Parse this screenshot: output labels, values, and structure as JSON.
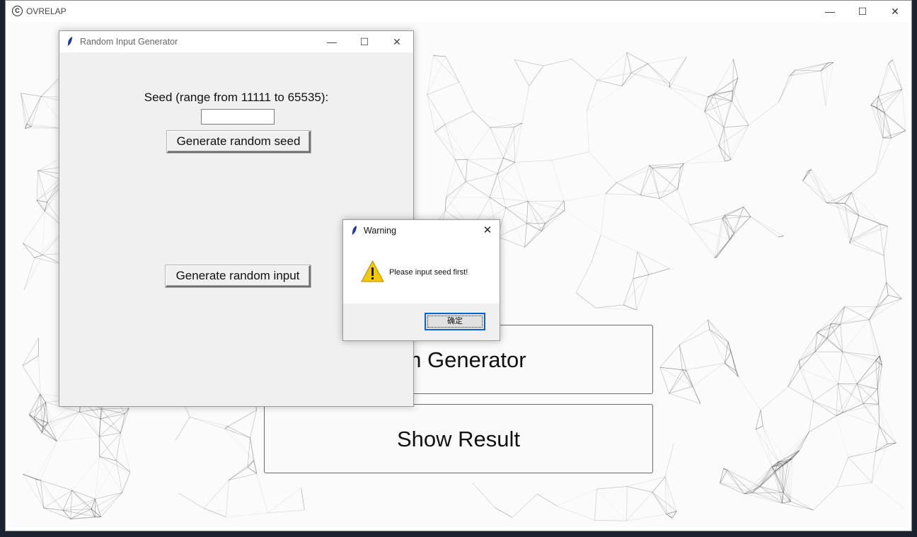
{
  "main_window": {
    "title": "OVRELAP",
    "app_icon_glyph": "C",
    "controls": {
      "minimize": "—",
      "maximize": "☐",
      "close": "✕"
    }
  },
  "main": {
    "generator_button_label": "om Generator",
    "show_result_button_label": "Show Result"
  },
  "random_input_window": {
    "title": "Random Input Generator",
    "controls": {
      "minimize": "—",
      "maximize": "☐",
      "close": "✕"
    },
    "seed_label": "Seed (range from 11111 to 65535):",
    "seed_value": "",
    "generate_seed_label": "Generate random seed",
    "generate_input_label": "Generate random input"
  },
  "warning_dialog": {
    "title": "Warning",
    "close": "✕",
    "message": "Please input seed first!",
    "ok_label": "确定"
  },
  "colors": {
    "warning_yellow": "#f6c800",
    "focus_blue": "#0a64c8",
    "network_line": "#555555"
  }
}
